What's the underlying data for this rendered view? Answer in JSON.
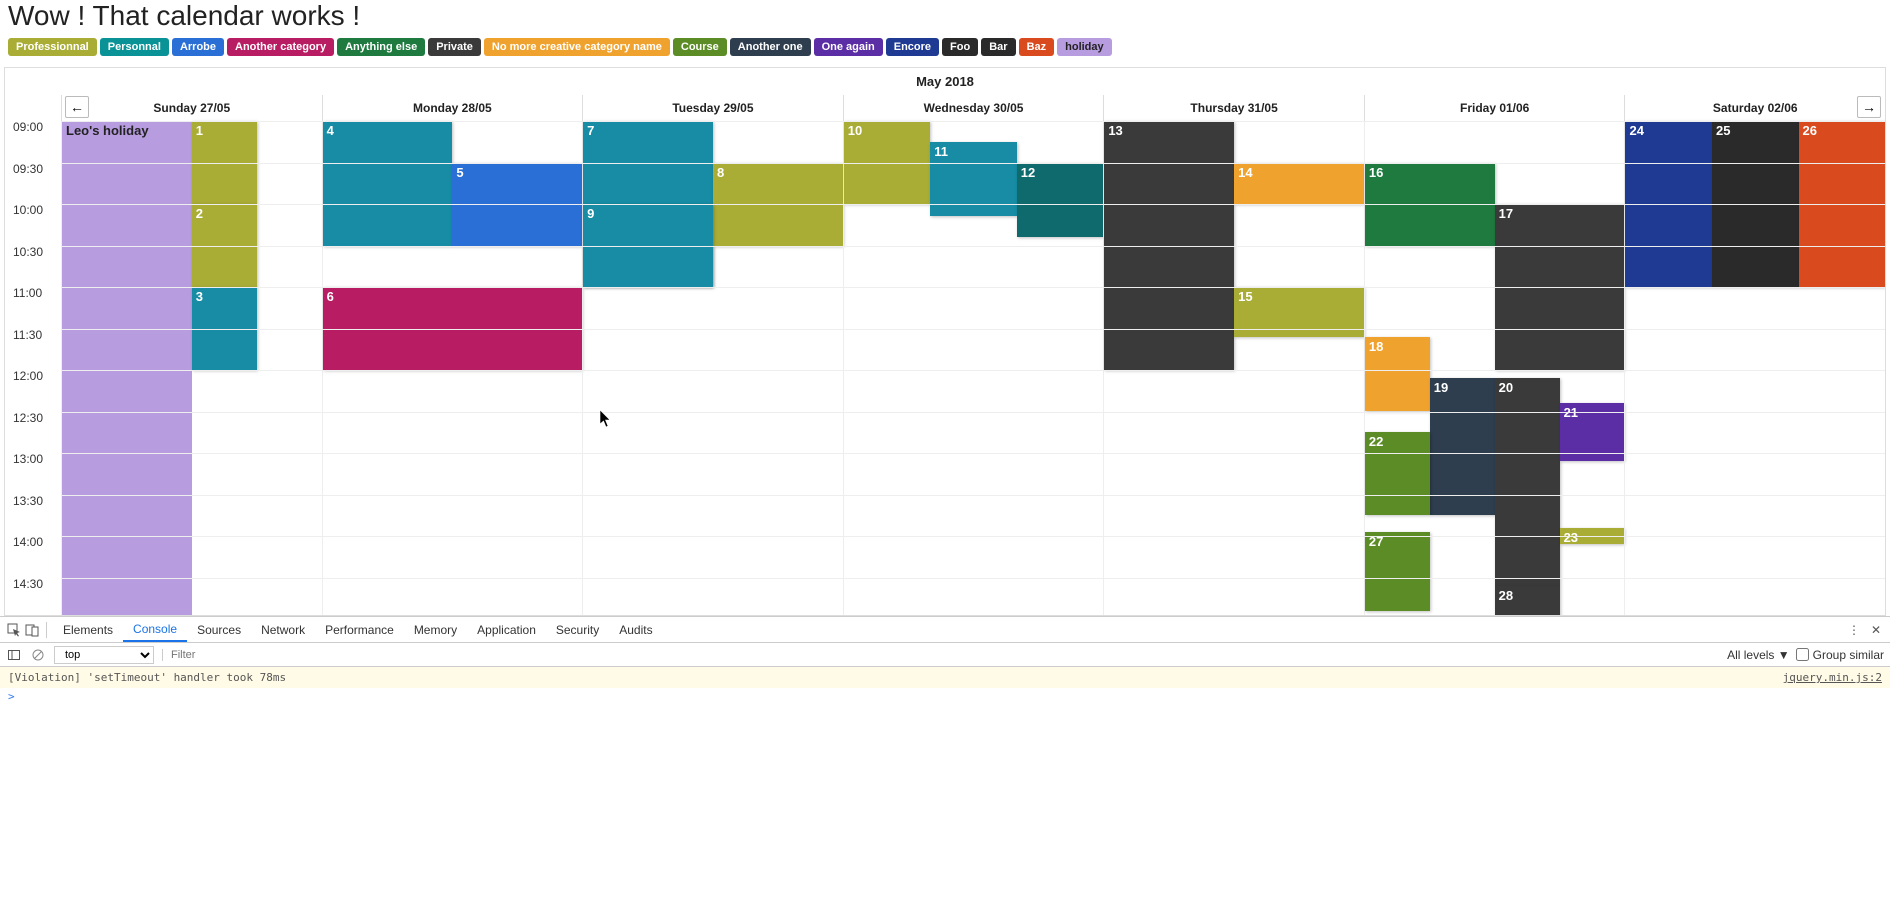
{
  "title": "Wow ! That calendar works !",
  "categories": [
    {
      "label": "Professionnal",
      "color": "#a9ad36"
    },
    {
      "label": "Personnal",
      "color": "#0a9396"
    },
    {
      "label": "Arrobe",
      "color": "#2a6fd6"
    },
    {
      "label": "Another category",
      "color": "#b81c62"
    },
    {
      "label": "Anything else",
      "color": "#1e7a3e"
    },
    {
      "label": "Private",
      "color": "#3a3a3a"
    },
    {
      "label": "No more creative category name",
      "color": "#f0a22e"
    },
    {
      "label": "Course",
      "color": "#5b8c26"
    },
    {
      "label": "Another one",
      "color": "#2e3e4e"
    },
    {
      "label": "One again",
      "color": "#5b2ea6"
    },
    {
      "label": "Encore",
      "color": "#1f3a93"
    },
    {
      "label": "Foo",
      "color": "#2a2a2a"
    },
    {
      "label": "Bar",
      "color": "#2a2a2a"
    },
    {
      "label": "Baz",
      "color": "#d94a1f"
    },
    {
      "label": "holiday",
      "color": "#b79ce0",
      "text": "#222"
    }
  ],
  "calendar": {
    "month_label": "May 2018",
    "nav_prev_icon": "←",
    "nav_next_icon": "→",
    "days": [
      "Sunday 27/05",
      "Monday 28/05",
      "Tuesday 29/05",
      "Wednesday 30/05",
      "Thursday 31/05",
      "Friday 01/06",
      "Saturday 02/06"
    ],
    "time_labels": [
      "09:00",
      "09:30",
      "10:00",
      "10:30",
      "11:00",
      "11:30",
      "12:00",
      "12:30",
      "13:00",
      "13:30",
      "14:00",
      "14:30"
    ],
    "holiday_event": {
      "label": "Leo's holiday"
    },
    "events": [
      {
        "n": "1",
        "day": 0,
        "start": 0,
        "end": 2,
        "lane": 0,
        "lanes": 2,
        "color": "#a9ad36"
      },
      {
        "n": "2",
        "day": 0,
        "start": 2,
        "end": 4,
        "lane": 0,
        "lanes": 2,
        "color": "#a9ad36"
      },
      {
        "n": "3",
        "day": 0,
        "start": 4,
        "end": 6,
        "lane": 0,
        "lanes": 2,
        "color": "#178ca4"
      },
      {
        "n": "4",
        "day": 1,
        "start": 0,
        "end": 3,
        "lane": 0,
        "lanes": 2,
        "color": "#178ca4"
      },
      {
        "n": "5",
        "day": 1,
        "start": 1,
        "end": 3,
        "lane": 1,
        "lanes": 2,
        "color": "#2a6fd6"
      },
      {
        "n": "6",
        "day": 1,
        "start": 4,
        "end": 6,
        "lane": 0,
        "lanes": 1,
        "color": "#b81c62"
      },
      {
        "n": "7",
        "day": 2,
        "start": 0,
        "end": 4,
        "lane": 0,
        "lanes": 2,
        "color": "#178ca4"
      },
      {
        "n": "8",
        "day": 2,
        "start": 1,
        "end": 3,
        "lane": 1,
        "lanes": 2,
        "color": "#a9ad36"
      },
      {
        "n": "9",
        "day": 2,
        "start": 2,
        "end": 4,
        "lane": 0,
        "lanes": 2,
        "color": "#178ca4"
      },
      {
        "n": "10",
        "day": 3,
        "start": 0,
        "end": 2,
        "lane": 0,
        "lanes": 3,
        "color": "#a9ad36"
      },
      {
        "n": "11",
        "day": 3,
        "start": 0.5,
        "end": 2.3,
        "lane": 1,
        "lanes": 3,
        "color": "#178ca4"
      },
      {
        "n": "12",
        "day": 3,
        "start": 1,
        "end": 2.8,
        "lane": 2,
        "lanes": 3,
        "color": "#0f6a6e"
      },
      {
        "n": "13",
        "day": 4,
        "start": 0,
        "end": 6,
        "lane": 0,
        "lanes": 2,
        "color": "#3a3a3a"
      },
      {
        "n": "14",
        "day": 4,
        "start": 1,
        "end": 2,
        "lane": 1,
        "lanes": 2,
        "color": "#f0a22e"
      },
      {
        "n": "15",
        "day": 4,
        "start": 4,
        "end": 5.2,
        "lane": 1,
        "lanes": 2,
        "color": "#a9ad36"
      },
      {
        "n": "16",
        "day": 5,
        "start": 1,
        "end": 3,
        "lane": 0,
        "lanes": 2,
        "color": "#1e7a3e"
      },
      {
        "n": "17",
        "day": 5,
        "start": 2,
        "end": 6,
        "lane": 1,
        "lanes": 2,
        "color": "#3a3a3a"
      },
      {
        "n": "18",
        "day": 5,
        "start": 5.2,
        "end": 7,
        "lane": 0,
        "lanes": 4,
        "color": "#f0a22e"
      },
      {
        "n": "19",
        "day": 5,
        "start": 6.2,
        "end": 9.5,
        "lane": 1,
        "lanes": 4,
        "color": "#2e3e4e"
      },
      {
        "n": "20",
        "day": 5,
        "start": 6.2,
        "end": 11.2,
        "lane": 2,
        "lanes": 4,
        "color": "#3a3a3a"
      },
      {
        "n": "21",
        "day": 5,
        "start": 6.8,
        "end": 8.2,
        "lane": 3,
        "lanes": 4,
        "color": "#5b2ea6"
      },
      {
        "n": "22",
        "day": 5,
        "start": 7.5,
        "end": 9.5,
        "lane": 0,
        "lanes": 4,
        "color": "#5b8c26"
      },
      {
        "n": "23",
        "day": 5,
        "start": 9.8,
        "end": 10.2,
        "lane": 3,
        "lanes": 4,
        "color": "#a9ad36"
      },
      {
        "n": "27",
        "day": 5,
        "start": 9.9,
        "end": 11.8,
        "lane": 0,
        "lanes": 4,
        "color": "#5b8c26"
      },
      {
        "n": "28",
        "day": 5,
        "start": 11.2,
        "end": 12,
        "lane": 2,
        "lanes": 4,
        "color": "#3a3a3a"
      },
      {
        "n": "24",
        "day": 6,
        "start": 0,
        "end": 4,
        "lane": 0,
        "lanes": 3,
        "color": "#1f3a93"
      },
      {
        "n": "25",
        "day": 6,
        "start": 0,
        "end": 4,
        "lane": 1,
        "lanes": 3,
        "color": "#2a2a2a"
      },
      {
        "n": "26",
        "day": 6,
        "start": 0,
        "end": 4,
        "lane": 2,
        "lanes": 3,
        "color": "#d94a1f"
      }
    ]
  },
  "devtools": {
    "tabs": [
      "Elements",
      "Console",
      "Sources",
      "Network",
      "Performance",
      "Memory",
      "Application",
      "Security",
      "Audits"
    ],
    "active_tab": "Console",
    "context_select": "top",
    "filter_placeholder": "Filter",
    "levels_label": "All levels ▼",
    "group_similar_label": "Group similar",
    "console_line": "[Violation] 'setTimeout' handler took 78ms",
    "console_link": "jquery.min.js:2",
    "prompt": ">"
  }
}
